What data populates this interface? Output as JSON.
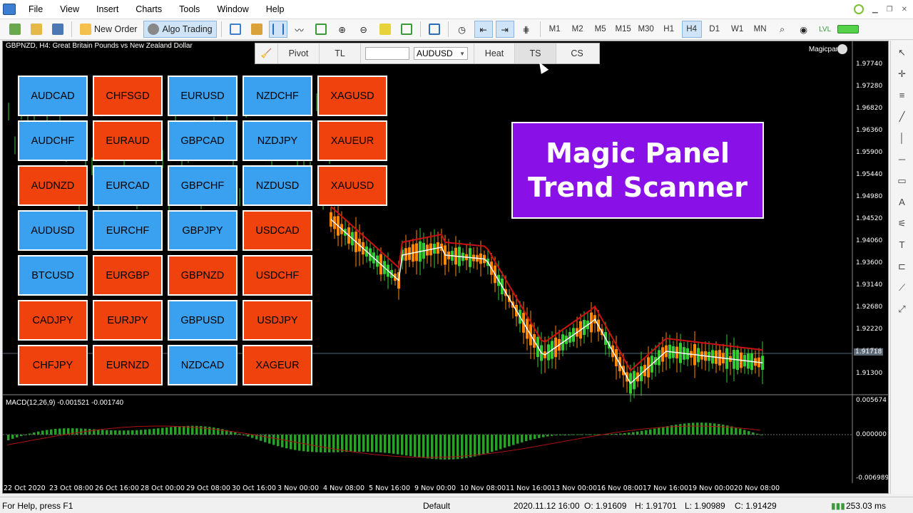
{
  "menu": [
    "File",
    "View",
    "Insert",
    "Charts",
    "Tools",
    "Window",
    "Help"
  ],
  "toolbar": {
    "new_order": "New Order",
    "algo_trading": "Algo Trading",
    "timeframes": [
      "M1",
      "M2",
      "M5",
      "M15",
      "M30",
      "H1",
      "H4",
      "D1",
      "W1",
      "MN"
    ],
    "active_timeframe": "H4"
  },
  "chart": {
    "title": "GBPNZD, H4:  Great Britain Pounds vs New Zealand Dollar",
    "ea_name": "Magicpanel",
    "indicator_label": "MACD(12,26,9) -0.001521 -0.001740",
    "price_labels": [
      "1.97740",
      "1.97280",
      "1.96820",
      "1.96360",
      "1.95900",
      "1.95440",
      "1.94980",
      "1.94520",
      "1.94060",
      "1.93600",
      "1.93140",
      "1.92680",
      "1.92220",
      "1.91760",
      "1.91300"
    ],
    "current_price": "1.91718",
    "macd_labels": [
      "0.005674",
      "0.000000",
      "-0.006989"
    ],
    "time_labels": [
      "22 Oct 2020",
      "23 Oct 08:00",
      "26 Oct 16:00",
      "28 Oct 00:00",
      "29 Oct 08:00",
      "30 Oct 16:00",
      "3 Nov 00:00",
      "4 Nov 08:00",
      "5 Nov 16:00",
      "9 Nov 00:00",
      "10 Nov 08:00",
      "11 Nov 16:00",
      "13 Nov 00:00",
      "16 Nov 08:00",
      "17 Nov 16:00",
      "19 Nov 00:00",
      "20 Nov 08:00"
    ]
  },
  "panel": {
    "buttons": [
      "Pivot",
      "TL",
      "Heat",
      "TS",
      "CS"
    ],
    "symbol": "AUDUSD",
    "active": "TS",
    "tiles": [
      {
        "label": "AUDCAD",
        "trend": "up"
      },
      {
        "label": "CHFSGD",
        "trend": "down"
      },
      {
        "label": "EURUSD",
        "trend": "up"
      },
      {
        "label": "NZDCHF",
        "trend": "up"
      },
      {
        "label": "XAGUSD",
        "trend": "down"
      },
      {
        "label": "AUDCHF",
        "trend": "up"
      },
      {
        "label": "EURAUD",
        "trend": "down"
      },
      {
        "label": "GBPCAD",
        "trend": "up"
      },
      {
        "label": "NZDJPY",
        "trend": "up"
      },
      {
        "label": "XAUEUR",
        "trend": "down"
      },
      {
        "label": "AUDNZD",
        "trend": "down"
      },
      {
        "label": "EURCAD",
        "trend": "up"
      },
      {
        "label": "GBPCHF",
        "trend": "up"
      },
      {
        "label": "NZDUSD",
        "trend": "up"
      },
      {
        "label": "XAUUSD",
        "trend": "down"
      },
      {
        "label": "AUDUSD",
        "trend": "up"
      },
      {
        "label": "EURCHF",
        "trend": "up"
      },
      {
        "label": "GBPJPY",
        "trend": "up"
      },
      {
        "label": "USDCAD",
        "trend": "down"
      },
      {
        "label": "BTCUSD",
        "trend": "up"
      },
      {
        "label": "EURGBP",
        "trend": "down"
      },
      {
        "label": "GBPNZD",
        "trend": "down"
      },
      {
        "label": "USDCHF",
        "trend": "down"
      },
      {
        "label": "CADJPY",
        "trend": "down"
      },
      {
        "label": "EURJPY",
        "trend": "down"
      },
      {
        "label": "GBPUSD",
        "trend": "up"
      },
      {
        "label": "USDJPY",
        "trend": "down"
      },
      {
        "label": "CHFJPY",
        "trend": "down"
      },
      {
        "label": "EURNZD",
        "trend": "down"
      },
      {
        "label": "NZDCAD",
        "trend": "up"
      },
      {
        "label": "XAGEUR",
        "trend": "down"
      }
    ],
    "banner_line1": "Magic Panel",
    "banner_line2": "Trend Scanner"
  },
  "status": {
    "help": "For Help, press F1",
    "profile": "Default",
    "datetime": "2020.11.12 16:00",
    "open": "O: 1.91609",
    "high": "H: 1.91701",
    "low": "L: 1.90989",
    "close": "C: 1.91429",
    "traffic": "253.03 ms"
  },
  "colors": {
    "trend_up": "#3aa0f0",
    "trend_down": "#f0420c",
    "banner": "#8a10e8",
    "bull": "#33cc33",
    "bear": "#ff8800",
    "ma_white": "#ffffff",
    "ma_red": "#cc1111"
  }
}
